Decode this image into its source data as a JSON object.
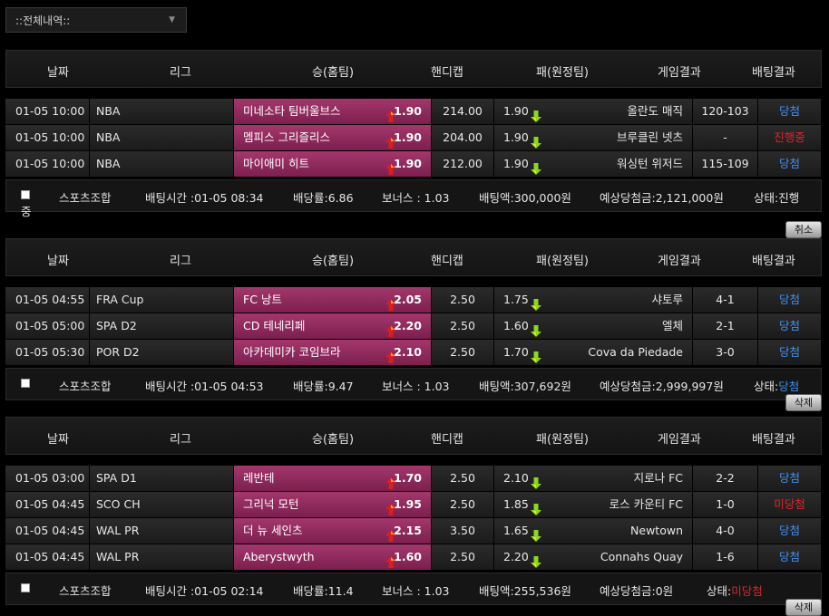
{
  "filter": {
    "label": "::전체내역::"
  },
  "headers": [
    "날짜",
    "리그",
    "승(홈팀)",
    "핸디캡",
    "패(원정팀)",
    "게임결과",
    "배팅결과"
  ],
  "groups": [
    {
      "rows": [
        {
          "date": "01-05 10:00",
          "league": "NBA",
          "home": "미네소타 팀버울브스",
          "home_odd": "1.90",
          "handicap": "214.00",
          "away_odd": "1.90",
          "away": "올란도 매직",
          "score": "120-103",
          "result": "당첨",
          "result_type": "win"
        },
        {
          "date": "01-05 10:00",
          "league": "NBA",
          "home": "멤피스 그리즐리스",
          "home_odd": "1.90",
          "handicap": "204.00",
          "away_odd": "1.90",
          "away": "브루클린 넷츠",
          "score": "-",
          "result": "진행중",
          "result_type": "lose"
        },
        {
          "date": "01-05 10:00",
          "league": "NBA",
          "home": "마이애미 히트",
          "home_odd": "1.90",
          "handicap": "212.00",
          "away_odd": "1.90",
          "away": "워싱턴 위저드",
          "score": "115-109",
          "result": "당첨",
          "result_type": "win"
        }
      ],
      "summary": {
        "type": "스포츠조합",
        "bet_time": "배팅시간 :01-05 08:34",
        "odds": "배당률:6.86",
        "bonus": "보너스 : 1.03",
        "amount": "배팅액:300,000원",
        "expected": "예상당첨금:2,121,000원",
        "status_label": "상태:",
        "status": "진행",
        "status_wrap": "중",
        "status_type": "plain"
      },
      "button": "취소"
    },
    {
      "rows": [
        {
          "date": "01-05 04:55",
          "league": "FRA Cup",
          "home": "FC 낭트",
          "home_odd": "2.05",
          "handicap": "2.50",
          "away_odd": "1.75",
          "away": "샤토루",
          "score": "4-1",
          "result": "당첨",
          "result_type": "win"
        },
        {
          "date": "01-05 05:00",
          "league": "SPA D2",
          "home": "CD 테네리페",
          "home_odd": "2.20",
          "handicap": "2.50",
          "away_odd": "1.60",
          "away": "엘체",
          "score": "2-1",
          "result": "당첨",
          "result_type": "win"
        },
        {
          "date": "01-05 05:30",
          "league": "POR D2",
          "home": "아카데미카 코임브라",
          "home_odd": "2.10",
          "handicap": "2.50",
          "away_odd": "1.70",
          "away": "Cova da Piedade",
          "score": "3-0",
          "result": "당첨",
          "result_type": "win"
        }
      ],
      "summary": {
        "type": "스포츠조합",
        "bet_time": "배팅시간 :01-05 04:53",
        "odds": "배당률:9.47",
        "bonus": "보너스 : 1.03",
        "amount": "배팅액:307,692원",
        "expected": "예상당첨금:2,999,997원",
        "status_label": "상태:",
        "status": "당첨",
        "status_wrap": "",
        "status_type": "win"
      },
      "button": "삭제"
    },
    {
      "rows": [
        {
          "date": "01-05 03:00",
          "league": "SPA D1",
          "home": "레반테",
          "home_odd": "1.70",
          "handicap": "2.50",
          "away_odd": "2.10",
          "away": "지로나 FC",
          "score": "2-2",
          "result": "당첨",
          "result_type": "win"
        },
        {
          "date": "01-05 04:45",
          "league": "SCO CH",
          "home": "그리넉 모턴",
          "home_odd": "1.95",
          "handicap": "2.50",
          "away_odd": "1.85",
          "away": "로스 카운티 FC",
          "score": "1-0",
          "result": "미당첨",
          "result_type": "lose"
        },
        {
          "date": "01-05 04:45",
          "league": "WAL PR",
          "home": "더 뉴 세인츠",
          "home_odd": "2.15",
          "handicap": "3.50",
          "away_odd": "1.65",
          "away": "Newtown",
          "score": "4-0",
          "result": "당첨",
          "result_type": "win"
        },
        {
          "date": "01-05 04:45",
          "league": "WAL PR",
          "home": "Aberystwyth",
          "home_odd": "1.60",
          "handicap": "2.50",
          "away_odd": "2.20",
          "away": "Connahs Quay",
          "score": "1-6",
          "result": "당첨",
          "result_type": "win"
        }
      ],
      "summary": {
        "type": "스포츠조합",
        "bet_time": "배팅시간 :01-05 02:14",
        "odds": "배당률:11.4",
        "bonus": "보너스 : 1.03",
        "amount": "배팅액:255,536원",
        "expected": "예상당첨금:0원",
        "status_label": "상태:",
        "status": "미당첨",
        "status_wrap": "",
        "status_type": "lose"
      },
      "button": "삭제"
    }
  ],
  "colors": {
    "home_bg": "#8e2a5c",
    "win": "#3f8ff0",
    "lose": "#e0242c",
    "up_arrow": "#d82020",
    "down_arrow": "#8ed81a"
  }
}
